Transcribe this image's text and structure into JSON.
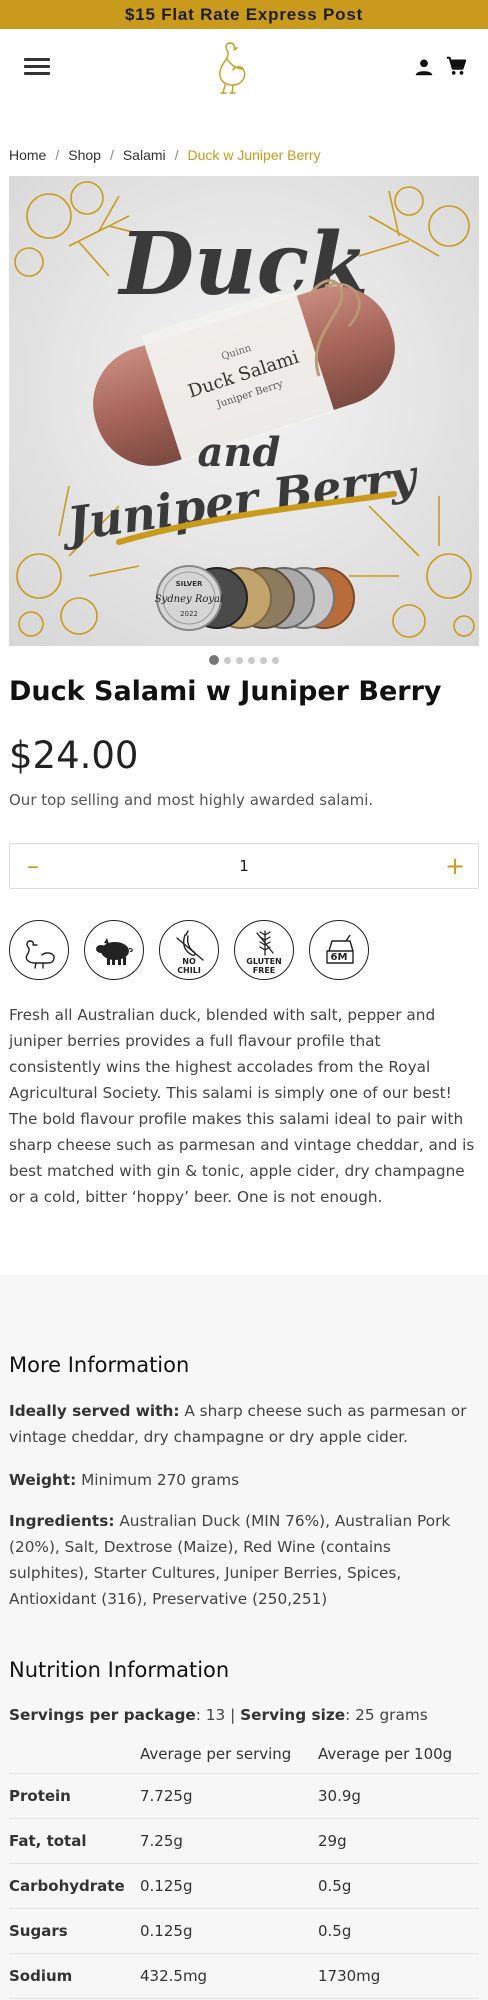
{
  "announcement": "$15 Flat Rate Express Post",
  "header": {
    "menu_icon": "hamburger-menu-icon",
    "logo_icon": "duck-logo-icon",
    "account_icon": "person-icon",
    "cart_icon": "shopping-cart-icon"
  },
  "breadcrumb": {
    "items": [
      "Home",
      "Shop",
      "Salami"
    ],
    "current": "Duck w Juniper Berry",
    "separator": "/"
  },
  "hero": {
    "headline_top": "Duck",
    "headline_mid": "and",
    "headline_bottom": "Juniper Berry",
    "label_brand": "Quinn",
    "label_title": "Duck Salami",
    "label_sub": "Juniper Berry",
    "medal_text": "SILVER",
    "medal_name": "Sydney Royal",
    "medal_year": "2022"
  },
  "carousel": {
    "count": 6,
    "active": 0
  },
  "product": {
    "title": "Duck Salami w Juniper Berry",
    "price": "$24.00",
    "tagline": "Our top selling and most highly awarded salami."
  },
  "quantity": {
    "minus": "–",
    "value": "1",
    "plus": "+"
  },
  "badges": [
    {
      "icon": "duck-icon",
      "label": ""
    },
    {
      "icon": "pig-icon",
      "label": ""
    },
    {
      "icon": "no-chili-icon",
      "label": "NO CHILI"
    },
    {
      "icon": "wheat-gluten-free-icon",
      "label": "GLUTEN FREE"
    },
    {
      "icon": "container-6m-icon",
      "label": "6M"
    }
  ],
  "badge_labels": {
    "no_chili": "NO CHILI",
    "gluten": "GLUTEN",
    "free": "FREE",
    "six_m": "6M",
    "no": "NO",
    "chili": "CHILI"
  },
  "description": "Fresh all Australian duck, blended with salt, pepper and juniper berries provides a full flavour profile that consistently wins the highest accolades from the Royal Agricultural Society. This salami is simply one of our best! The bold flavour profile makes this salami ideal to pair with sharp cheese such as parmesan and vintage cheddar, and is best matched with gin & tonic, apple cider, dry champagne or a cold, bitter ‘hoppy’ beer. One is not enough.",
  "more_info": {
    "heading": "More Information",
    "served_label": "Ideally served with:",
    "served_value": " A sharp cheese such as parmesan or vintage cheddar, dry champagne or dry apple cider.",
    "weight_label": "Weight:",
    "weight_value": " Minimum 270 grams",
    "ingredients_label": "Ingredients:",
    "ingredients_value": " Australian Duck (MIN 76%), Australian Pork (20%), Salt, Dextrose (Maize), Red Wine (contains sulphites), Starter Cultures, Juniper Berries, Spices, Antioxidant (316), Preservative (250,251)"
  },
  "nutrition": {
    "heading": "Nutrition Information",
    "servings_label": "Servings per package",
    "servings_value": ": 13 | ",
    "size_label": "Serving size",
    "size_value": ": 25 grams",
    "columns": [
      "",
      "Average per serving",
      "Average per 100g"
    ],
    "rows": [
      [
        "Protein",
        "7.725g",
        "30.9g"
      ],
      [
        "Fat, total",
        "7.25g",
        "29g"
      ],
      [
        "Carbohydrate",
        "0.125g",
        "0.5g"
      ],
      [
        "Sugars",
        "0.125g",
        "0.5g"
      ],
      [
        "Sodium",
        "432.5mg",
        "1730mg"
      ]
    ]
  },
  "colors": {
    "accent_gold": "#c99a1b",
    "text_dark": "#111111",
    "panel_bg": "#f7f7f7"
  }
}
